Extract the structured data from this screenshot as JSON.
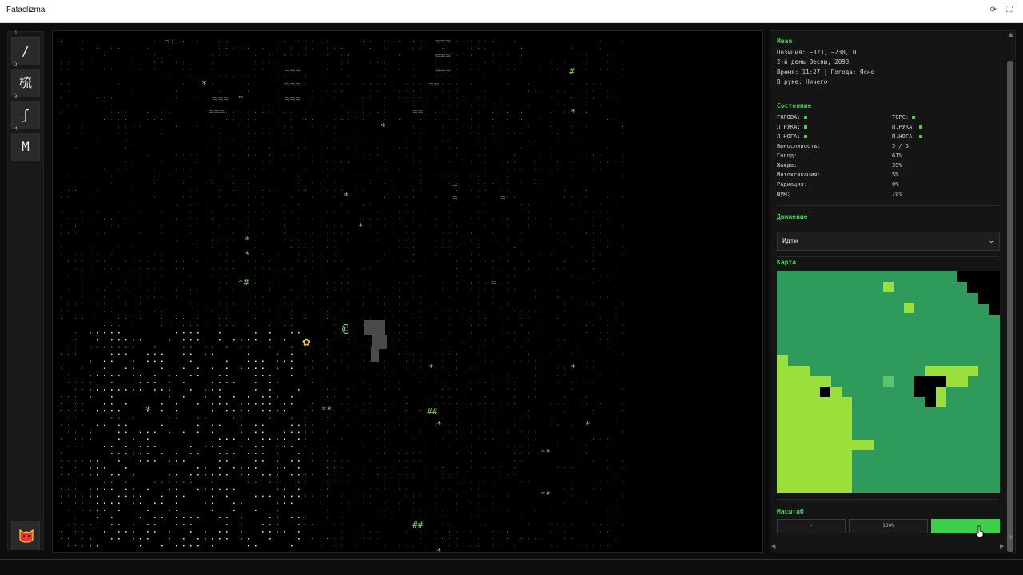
{
  "window": {
    "title": "Fataclizma",
    "reload_icon": "⟳",
    "fullscreen_icon": "⛶"
  },
  "toolbar": {
    "slots": [
      {
        "num": "1",
        "glyph": "/"
      },
      {
        "num": "2",
        "glyph": "梳"
      },
      {
        "num": "3",
        "glyph": "ʃ"
      },
      {
        "num": "4",
        "glyph": "M"
      }
    ],
    "bottom_icon": "mask-icon"
  },
  "map": {
    "player": "@",
    "flower": "✿"
  },
  "character": {
    "name": "Иван",
    "position": "Позиция: −323, −230, 0",
    "date": "2-й день Весны, 2093",
    "time_weather": "Время: 11:27 | Погода: Ясно",
    "in_hand": "В руке: Ничего"
  },
  "status": {
    "title": "Состояние",
    "body_parts": [
      {
        "label": "ГОЛОВА:",
        "color": "#3ecf5a"
      },
      {
        "label": "ТОРС:",
        "color": "#3ecf5a"
      },
      {
        "label": "Л.РУКА:",
        "color": "#3ecf5a"
      },
      {
        "label": "П.РУКА:",
        "color": "#3ecf5a"
      },
      {
        "label": "Л.НОГА:",
        "color": "#3ecf5a"
      },
      {
        "label": "П.НОГА:",
        "color": "#3ecf5a"
      }
    ],
    "stats": [
      {
        "label": "Выносливость:",
        "value": "5 / 5"
      },
      {
        "label": "Голод:",
        "value": "61%"
      },
      {
        "label": "Жажда:",
        "value": "39%"
      },
      {
        "label": "Интоксикация:",
        "value": "5%"
      },
      {
        "label": "Радиация:",
        "value": "0%"
      },
      {
        "label": "Шум:",
        "value": "70%"
      }
    ]
  },
  "movement": {
    "title": "Движение",
    "selected": "Идти"
  },
  "minimap": {
    "title": "Карта",
    "colors": {
      "grass": "#2e9b5c",
      "bright": "#9be03a",
      "dark": "#000000",
      "mid": "#5cc46a"
    }
  },
  "zoom": {
    "title": "Масштаб",
    "minus": "-",
    "value": "100%",
    "plus": "+"
  },
  "colors": {
    "accent": "#3ecf5a"
  }
}
